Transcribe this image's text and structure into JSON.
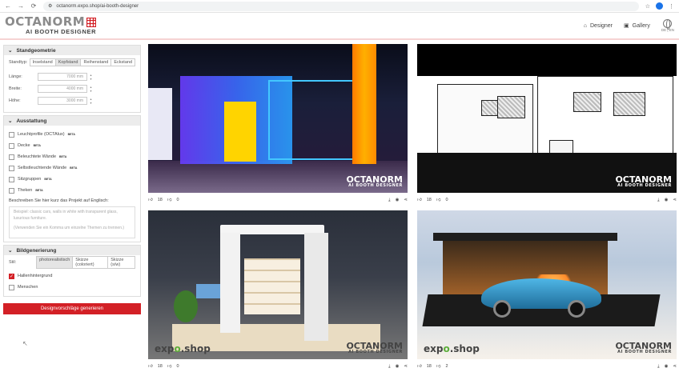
{
  "browser": {
    "url": "octanorm.expo.shop/ai-booth-designer",
    "nav": [
      "←",
      "→",
      "⟳"
    ]
  },
  "header": {
    "brand": "OCTANORM",
    "sub": "AI BOOTH DESIGNER",
    "nav": [
      {
        "icon": "home-icon",
        "glyph": "⌂",
        "label": "Designer"
      },
      {
        "icon": "gallery-icon",
        "glyph": "▣",
        "label": "Gallery"
      }
    ],
    "lang": "DE | EN"
  },
  "sidebar": {
    "geometry": {
      "title": "Standgeometrie",
      "standtyp_label": "Standtyp:",
      "standtyp_options": [
        "Inselstand",
        "Kopfstand",
        "Reihenstand",
        "Eckstand"
      ],
      "standtyp_active": "Kopfstand",
      "fields": [
        {
          "label": "Länge:",
          "value": "7000 mm"
        },
        {
          "label": "Breite:",
          "value": "4000 mm"
        },
        {
          "label": "Höhe:",
          "value": "3000 mm"
        }
      ]
    },
    "equipment": {
      "title": "Ausstattung",
      "items": [
        {
          "label": "Leuchtprofile (OCTAlux)",
          "badge": "BETA"
        },
        {
          "label": "Decke",
          "badge": "BETA"
        },
        {
          "label": "Beleuchtete Wände",
          "badge": "BETA"
        },
        {
          "label": "Selbstleuchtende Wände",
          "badge": "BETA"
        },
        {
          "label": "Sitzgruppen",
          "badge": "BETA"
        },
        {
          "label": "Theken",
          "badge": "BETA"
        }
      ],
      "desc_label": "Beschreiben Sie hier kurz das Projekt auf Englisch:",
      "desc_placeholder_1": "Beispiel: classic cars, walls in white with transparent glass, luxurious furniture.",
      "desc_placeholder_2": "(Verwenden Sie ein Komma um einzelne Themen zu trennen.)"
    },
    "image_gen": {
      "title": "Bildgenerierung",
      "style_label": "Stil:",
      "style_options": [
        "photorealistisch",
        "Skizze (coloriert)",
        "Skizze (s/w)"
      ],
      "style_active": "photorealistisch",
      "options": [
        {
          "label": "Hallenhintergrund",
          "checked": true
        },
        {
          "label": "Menschen",
          "checked": false
        }
      ]
    },
    "generate_button": "Designvorschläge generieren"
  },
  "gallery": {
    "cards": [
      {
        "likes": "18",
        "dislikes": "0",
        "watermark": "OCTANORM",
        "watermark_sub": "AI BOOTH DESIGNER",
        "expo": ""
      },
      {
        "likes": "18",
        "dislikes": "0",
        "watermark": "OCTANORM",
        "watermark_sub": "AI BOOTH DESIGNER",
        "expo": ""
      },
      {
        "likes": "18",
        "dislikes": "0",
        "watermark": "OCTANORM",
        "watermark_sub": "AI BOOTH DESIGNER",
        "expo": "expo.shop"
      },
      {
        "likes": "18",
        "dislikes": "2",
        "watermark": "OCTANORM",
        "watermark_sub": "AI BOOTH DESIGNER",
        "expo": "expo.shop"
      }
    ]
  }
}
